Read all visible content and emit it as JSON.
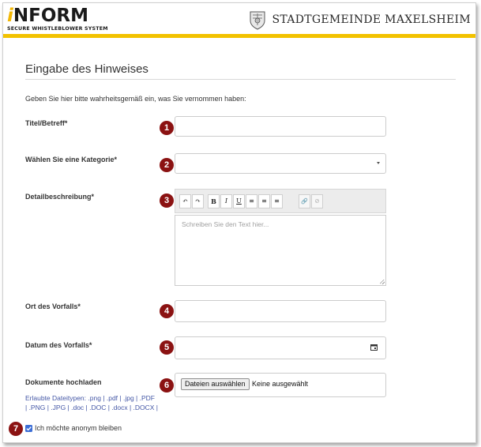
{
  "header": {
    "logo_prefix": "i",
    "logo_main": "NFORM",
    "logo_tagline": "SECURE WHISTLEBLOWER SYSTEM",
    "municipality": "Stadtgemeinde Maxelsheim",
    "accent_color": "#f2c200"
  },
  "form": {
    "title": "Eingabe des Hinweises",
    "intro": "Geben Sie hier bitte wahrheitsgemäß ein, was Sie vernommen haben:",
    "fields": {
      "title_label": "Titel/Betreff*",
      "category_label": "Wählen Sie eine Kategorie*",
      "description_label": "Detailbeschreibung*",
      "description_placeholder": "Schreiben Sie den Text hier...",
      "location_label": "Ort des Vorfalls*",
      "date_label": "Datum des Vorfalls*",
      "upload_label": "Dokumente hochladen",
      "upload_button": "Dateien auswählen",
      "upload_status": "Keine ausgewählt",
      "allowed_types_line1": "Erlaubte Dateitypen: .png | .pdf | .jpg | .PDF",
      "allowed_types_line2": "| .PNG | .JPG | .doc | .DOC | .docx | .DOCX |"
    },
    "toolbar": {
      "undo": "↶",
      "redo": "↷",
      "bold": "B",
      "italic": "I",
      "underline": "U",
      "align_left": "≡",
      "align_center": "≡",
      "align_right": "≡",
      "link": "🔗",
      "unlink": "⊘"
    },
    "anonymous_label": "Ich möchte anonym bleiben",
    "anonymous_checked": true
  },
  "badges": [
    "1",
    "2",
    "3",
    "4",
    "5",
    "6",
    "7"
  ],
  "colors": {
    "badge": "#8b1212",
    "link_text": "#4457a6",
    "checkbox": "#3d6fd6"
  }
}
